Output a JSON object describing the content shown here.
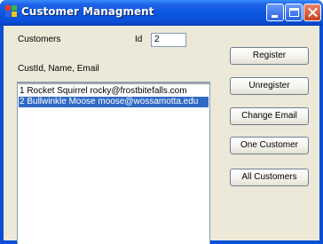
{
  "window": {
    "title": "Customer Managment"
  },
  "form": {
    "customers_label": "Customers",
    "id_label": "Id",
    "id_value": "2",
    "columns_label": "CustId, Name, Email"
  },
  "list": {
    "items": [
      "1 Rocket Squirrel rocky@frostbitefalls.com",
      "2 Bullwinkle Moose moose@wossamotta.edu"
    ],
    "selected_index": 1
  },
  "buttons": {
    "register": "Register",
    "unregister": "Unregister",
    "change_email": "Change Email",
    "one_customer": "One Customer",
    "all_customers": "All Customers"
  },
  "colors": {
    "titlebar": "#0a4fd6",
    "client_background": "#ece9d8",
    "selection": "#316ac5"
  }
}
